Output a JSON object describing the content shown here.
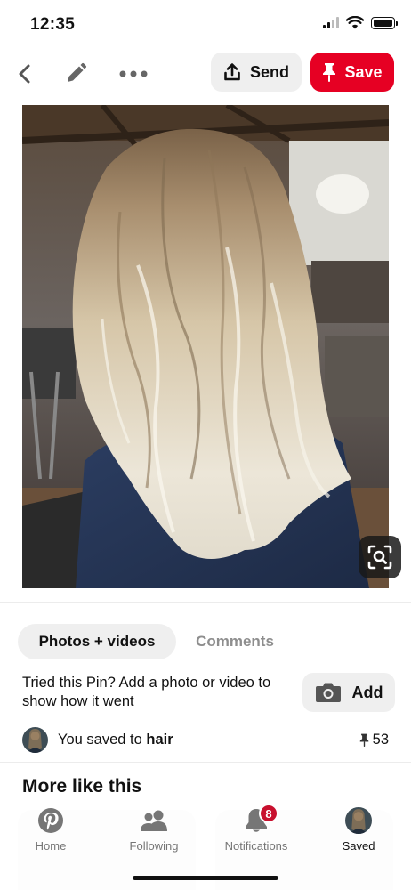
{
  "status": {
    "time": "12:35"
  },
  "toolbar": {
    "back_icon": "chevron-left-icon",
    "edit_icon": "pencil-icon",
    "more_icon": "ellipsis-icon",
    "send_label": "Send",
    "save_label": "Save"
  },
  "pin": {
    "image_subject": "Long wavy blonde balayage hair viewed from behind in a salon",
    "lens_icon": "visual-search-icon"
  },
  "tabs": {
    "active": "Photos + videos",
    "inactive": "Comments"
  },
  "tried": {
    "text": "Tried this Pin? Add a photo or video to show how it went",
    "add_label": "Add"
  },
  "saved": {
    "prefix": "You saved to ",
    "board": "hair",
    "save_count": "53"
  },
  "more_title": "More like this",
  "bottom_nav": {
    "items": [
      {
        "label": "Home",
        "icon": "pinterest-logo-icon"
      },
      {
        "label": "Following",
        "icon": "people-icon"
      },
      {
        "label": "Notifications",
        "icon": "bell-icon",
        "badge": "8"
      },
      {
        "label": "Saved",
        "icon": "profile-avatar"
      }
    ]
  },
  "colors": {
    "accent": "#e60023",
    "badge": "#c8102e",
    "muted": "#8e8e8e"
  }
}
